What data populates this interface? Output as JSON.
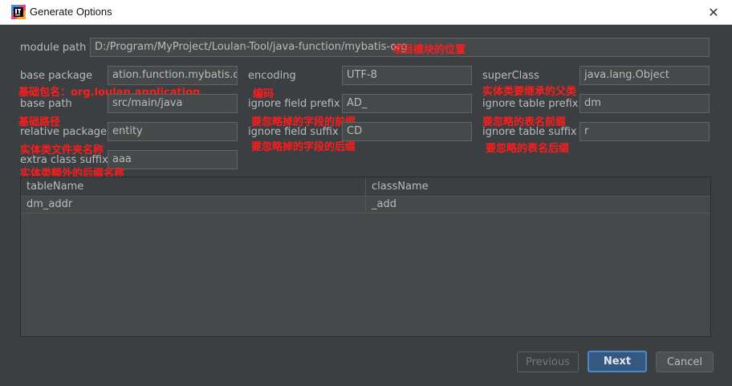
{
  "window": {
    "title": "Generate Options",
    "close_glyph": "✕"
  },
  "form": {
    "module_path": {
      "label": "module path",
      "value": "D:/Program/MyProject/Loulan-Tool/java-function/mybatis-org"
    },
    "base_package": {
      "label": "base package",
      "value": "ation.function.mybatis.org"
    },
    "encoding": {
      "label": "encoding",
      "value": "UTF-8"
    },
    "super_class": {
      "label": "superClass",
      "value": "java.lang.Object"
    },
    "base_path": {
      "label": "base path",
      "value": "src/main/java"
    },
    "ignore_field_prefix": {
      "label": "ignore field prefix",
      "value": "AD_"
    },
    "ignore_table_prefix": {
      "label": "ignore table prefix",
      "value": "dm"
    },
    "relative_package": {
      "label": "relative package",
      "value": "entity"
    },
    "ignore_field_suffix": {
      "label": "ignore field suffix",
      "value": "CD"
    },
    "ignore_table_suffix": {
      "label": "ignore table suffix",
      "value": "r"
    },
    "extra_class_suffix": {
      "label": "extra class suffix",
      "value": "aaa"
    }
  },
  "annotations": {
    "module_path": "项目模块的位置",
    "base_package": "基础包名：org.loulan.application",
    "encoding": "编码",
    "super_class": "实体类要继承的父类",
    "base_path": "基础路径",
    "ignore_field_prefix": "要忽略掉的字段的前缀",
    "ignore_table_prefix": "要忽略的表名前缀",
    "relative_package": "实体类文件夹名称",
    "ignore_field_suffix": "要忽略掉的字段的后缀",
    "ignore_table_suffix": "要忽略的表名后缀",
    "extra_class_suffix": "实体类额外的后缀名称"
  },
  "table": {
    "columns": [
      "tableName",
      "className"
    ],
    "rows": [
      [
        "dm_addr",
        "_add"
      ]
    ]
  },
  "buttons": {
    "previous": "Previous",
    "next": "Next",
    "cancel": "Cancel"
  },
  "colors": {
    "annotation": "#ff1c1c",
    "accent": "#4a88c7",
    "background": "#3c3f41",
    "field": "#45494a"
  }
}
